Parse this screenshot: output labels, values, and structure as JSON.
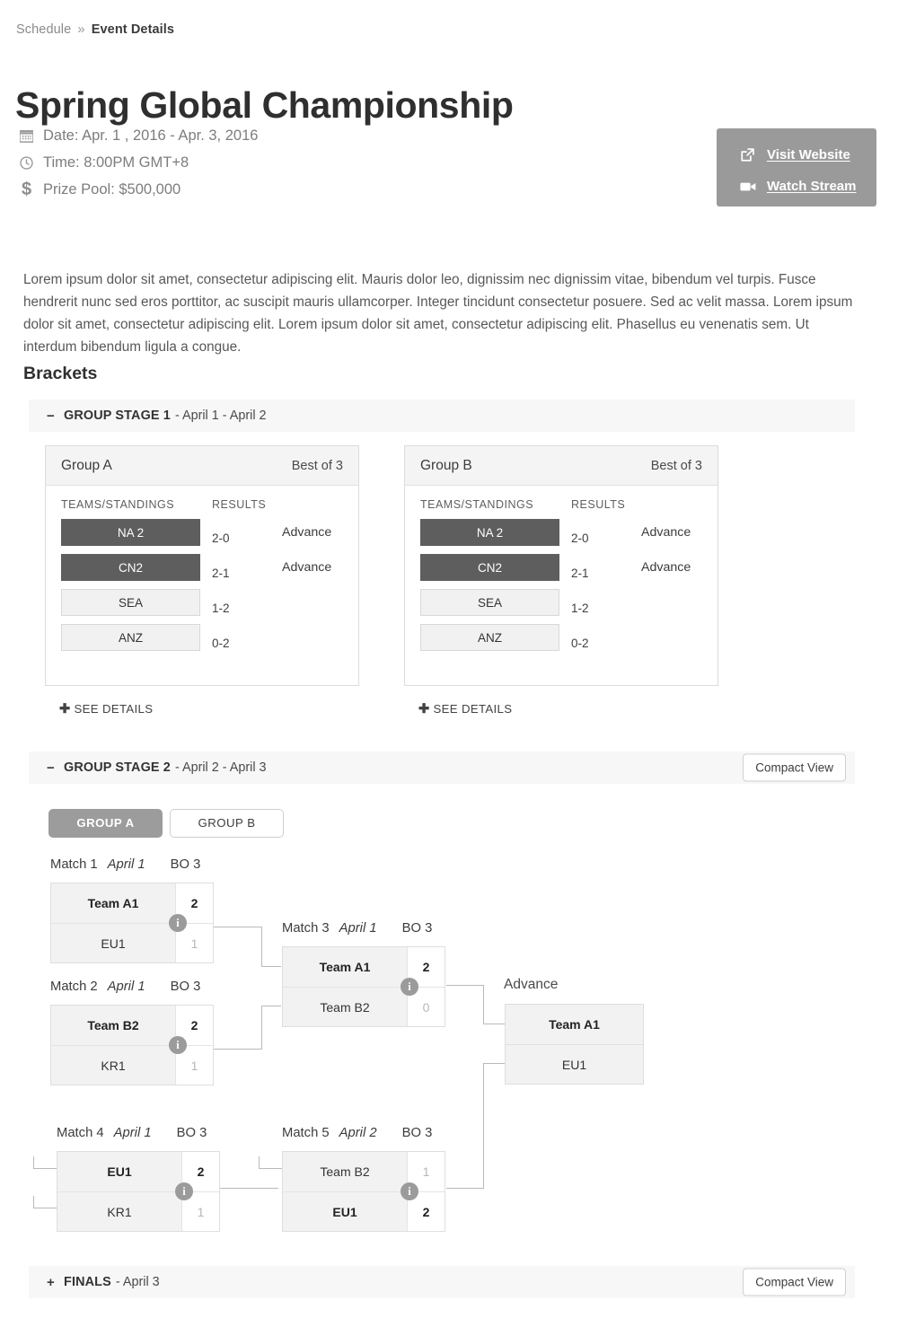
{
  "breadcrumb": {
    "parent": "Schedule",
    "separator": "»",
    "current": "Event Details"
  },
  "title": "Spring Global Championship",
  "meta": {
    "date": "Date: Apr. 1 , 2016 - Apr. 3, 2016",
    "time": "Time: 8:00PM GMT+8",
    "prize": "Prize Pool: $500,000"
  },
  "actions": {
    "visit_website": "Visit Website",
    "watch_stream": "Watch Stream",
    "panel_color": "#9a9a9a"
  },
  "description": "Lorem ipsum dolor sit amet, consectetur adipiscing elit. Mauris dolor leo, dignissim nec dignissim vitae, bibendum vel turpis. Fusce hendrerit nunc sed eros porttitor, ac suscipit mauris ullamcorper. Integer tincidunt consectetur posuere. Sed ac velit massa. Lorem ipsum dolor sit amet, consectetur adipiscing elit. Lorem ipsum dolor sit amet, consectetur adipiscing elit. Phasellus eu venenatis sem. Ut interdum bibendum ligula a congue.",
  "brackets_heading": "Brackets",
  "stage1": {
    "toggle": "−",
    "name": "GROUP STAGE 1",
    "dates": "-  April 1 - April 2",
    "groups": [
      {
        "title": "Group A",
        "best_of": "Best of 3",
        "col_teams": "TEAMS/STANDINGS",
        "col_results": "RESULTS",
        "see_details": "SEE DETAILS",
        "rows": [
          {
            "team": "NA 2",
            "score": "2-0",
            "status": "Advance",
            "advancing": true
          },
          {
            "team": "CN2",
            "score": "2-1",
            "status": "Advance",
            "advancing": true
          },
          {
            "team": "SEA",
            "score": "1-2",
            "status": "",
            "advancing": false
          },
          {
            "team": "ANZ",
            "score": "0-2",
            "status": "",
            "advancing": false
          }
        ]
      },
      {
        "title": "Group B",
        "best_of": "Best of 3",
        "col_teams": "TEAMS/STANDINGS",
        "col_results": "RESULTS",
        "see_details": "SEE DETAILS",
        "rows": [
          {
            "team": "NA 2",
            "score": "2-0",
            "status": "Advance",
            "advancing": true
          },
          {
            "team": "CN2",
            "score": "2-1",
            "status": "Advance",
            "advancing": true
          },
          {
            "team": "SEA",
            "score": "1-2",
            "status": "",
            "advancing": false
          },
          {
            "team": "ANZ",
            "score": "0-2",
            "status": "",
            "advancing": false
          }
        ]
      }
    ]
  },
  "stage2": {
    "toggle": "−",
    "name": "GROUP STAGE 2",
    "dates": "-  April 2 - April 3",
    "compact_view": "Compact View",
    "tabs": [
      {
        "label": "GROUP A",
        "active": true
      },
      {
        "label": "GROUP B",
        "active": false
      }
    ],
    "advance_label": "Advance",
    "info_badge": "i",
    "matches": [
      {
        "label": "Match 1",
        "date": "April 1",
        "bo": "BO 3",
        "rows": [
          {
            "name": "Team A1",
            "score": "2",
            "win": true
          },
          {
            "name": "EU1",
            "score": "1",
            "win": false
          }
        ]
      },
      {
        "label": "Match 2",
        "date": "April 1",
        "bo": "BO 3",
        "rows": [
          {
            "name": "Team B2",
            "score": "2",
            "win": true
          },
          {
            "name": "KR1",
            "score": "1",
            "win": false
          }
        ]
      },
      {
        "label": "Match 3",
        "date": "April 1",
        "bo": "BO 3",
        "rows": [
          {
            "name": "Team A1",
            "score": "2",
            "win": true
          },
          {
            "name": "Team B2",
            "score": "0",
            "win": false
          }
        ]
      },
      {
        "label": "Match 4",
        "date": "April 1",
        "bo": "BO 3",
        "rows": [
          {
            "name": "EU1",
            "score": "2",
            "win": true
          },
          {
            "name": "KR1",
            "score": "1",
            "win": false
          }
        ]
      },
      {
        "label": "Match 5",
        "date": "April 2",
        "bo": "BO 3",
        "rows": [
          {
            "name": "Team B2",
            "score": "1",
            "win": false
          },
          {
            "name": "EU1",
            "score": "2",
            "win": true
          }
        ]
      }
    ],
    "advance_box": [
      {
        "name": "Team A1",
        "win": true
      },
      {
        "name": "EU1",
        "win": false
      }
    ]
  },
  "finals": {
    "toggle": "+",
    "name": "FINALS",
    "dates": "- April 3",
    "compact_view": "Compact View"
  }
}
